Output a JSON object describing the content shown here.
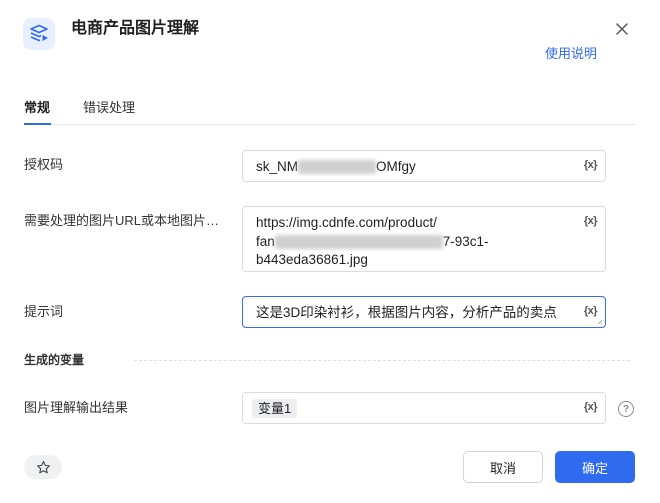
{
  "header": {
    "title": "电商产品图片理解",
    "help_link": "使用说明",
    "app_icon": "layers-play-icon",
    "close_icon": "close-icon"
  },
  "tabs": [
    {
      "label": "常规",
      "active": true
    },
    {
      "label": "错误处理",
      "active": false
    }
  ],
  "fields": {
    "auth_code": {
      "label": "授权码",
      "value_prefix": "sk_NM",
      "value_suffix": "OMfgy",
      "var_button": "{x}"
    },
    "image_url": {
      "label": "需要处理的图片URL或本地图片…",
      "line1": "https://img.cdnfe.com/product/",
      "line2_prefix": "fan",
      "line2_suffix": "7-93c1-",
      "line3": "b443eda36861.jpg",
      "var_button": "{x}"
    },
    "prompt": {
      "label": "提示词",
      "value": "这是3D印染衬衫，根据图片内容，分析产品的卖点",
      "var_button": "{x}"
    }
  },
  "outputs": {
    "section_title": "生成的变量",
    "result": {
      "label": "图片理解输出结果",
      "chip": "变量1",
      "var_button": "{x}",
      "help_glyph": "?"
    }
  },
  "footer": {
    "cancel_label": "取消",
    "ok_label": "确定",
    "star_icon": "star-icon"
  },
  "colors": {
    "accent": "#2f6bef",
    "border": "#dcdcdc",
    "chip_bg": "#eceef2"
  }
}
